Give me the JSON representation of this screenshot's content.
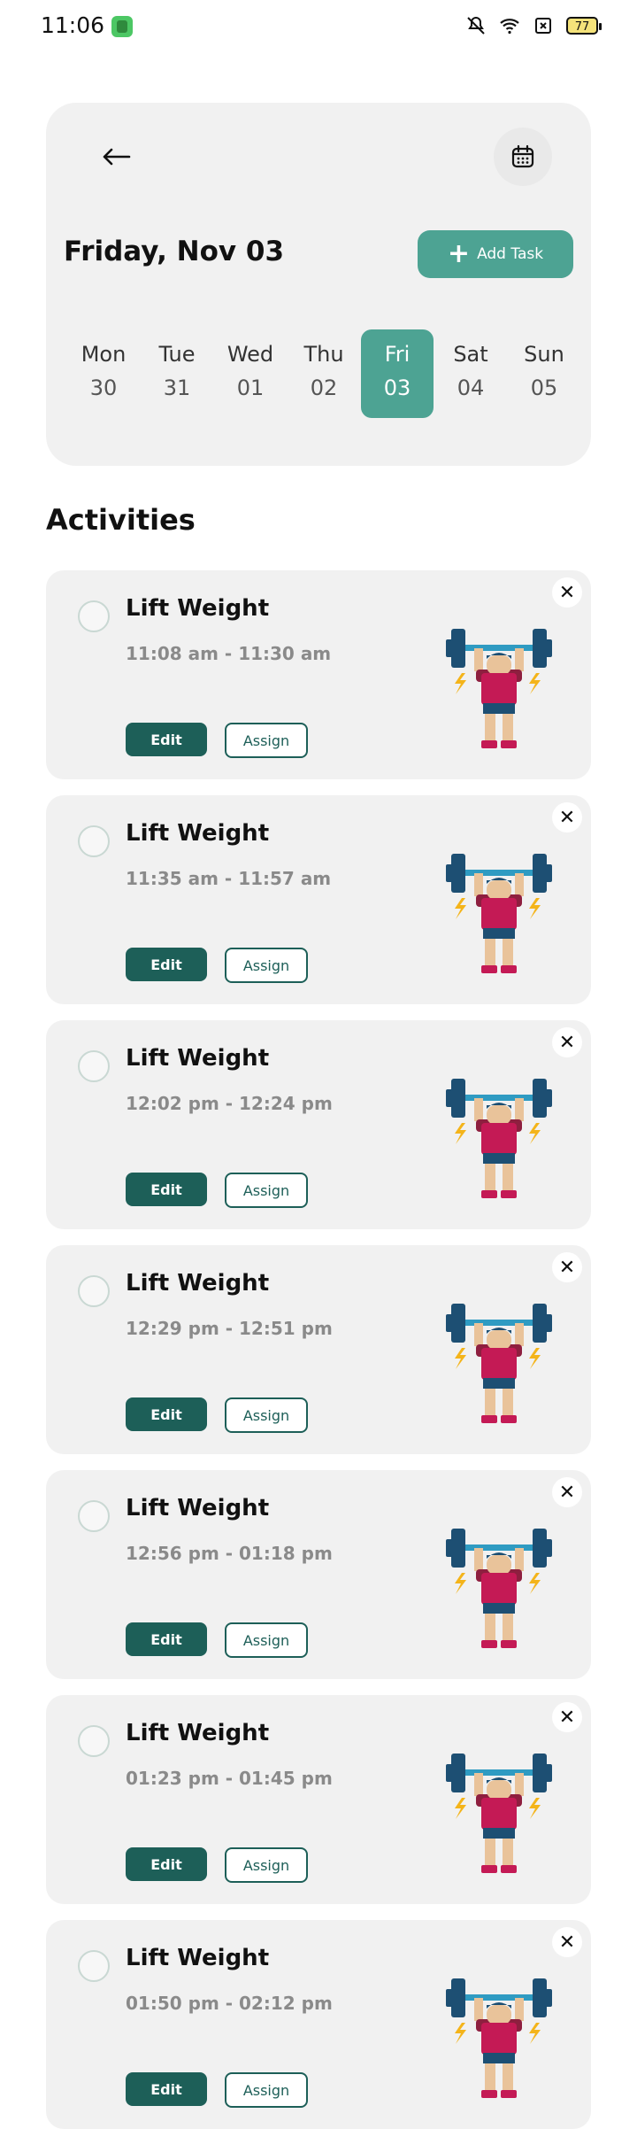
{
  "status_bar": {
    "time": "11:06",
    "battery": "77"
  },
  "header": {
    "date_title": "Friday, Nov 03",
    "add_task_label": "Add Task",
    "accent_color": "#4da393"
  },
  "week": [
    {
      "name": "Mon",
      "date": "30",
      "active": false
    },
    {
      "name": "Tue",
      "date": "31",
      "active": false
    },
    {
      "name": "Wed",
      "date": "01",
      "active": false
    },
    {
      "name": "Thu",
      "date": "02",
      "active": false
    },
    {
      "name": "Fri",
      "date": "03",
      "active": true
    },
    {
      "name": "Sat",
      "date": "04",
      "active": false
    },
    {
      "name": "Sun",
      "date": "05",
      "active": false
    }
  ],
  "activities_title": "Activities",
  "activities": [
    {
      "title": "Lift Weight",
      "time": "11:08 am - 11:30 am",
      "edit_label": "Edit",
      "assign_label": "Assign"
    },
    {
      "title": "Lift Weight",
      "time": "11:35 am - 11:57 am",
      "edit_label": "Edit",
      "assign_label": "Assign"
    },
    {
      "title": "Lift Weight",
      "time": "12:02 pm - 12:24 pm",
      "edit_label": "Edit",
      "assign_label": "Assign"
    },
    {
      "title": "Lift Weight",
      "time": "12:29 pm - 12:51 pm",
      "edit_label": "Edit",
      "assign_label": "Assign"
    },
    {
      "title": "Lift Weight",
      "time": "12:56 pm - 01:18 pm",
      "edit_label": "Edit",
      "assign_label": "Assign"
    },
    {
      "title": "Lift Weight",
      "time": "01:23 pm - 01:45 pm",
      "edit_label": "Edit",
      "assign_label": "Assign"
    },
    {
      "title": "Lift Weight",
      "time": "01:50 pm - 02:12 pm",
      "edit_label": "Edit",
      "assign_label": "Assign"
    }
  ]
}
